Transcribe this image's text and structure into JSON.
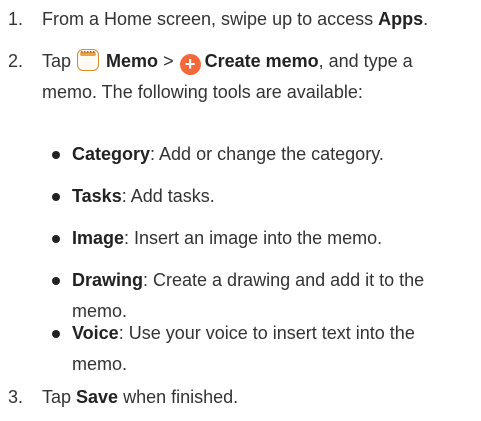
{
  "steps": [
    {
      "num": "1.",
      "pre": "From a Home screen, swipe up to access ",
      "bold": "Apps",
      "post": "."
    },
    {
      "num": "2.",
      "tap": "Tap ",
      "memo": "Memo",
      "sep": " > ",
      "create": "Create memo",
      "rest_line1": ", and type a",
      "rest_line2": "memo. The following tools are available:"
    },
    {
      "num": "3.",
      "tap": "Tap ",
      "bold": "Save",
      "post": " when finished."
    }
  ],
  "tools": [
    {
      "name": "Category",
      "desc": ": Add or change the category."
    },
    {
      "name": "Tasks",
      "desc": ": Add tasks."
    },
    {
      "name": "Image",
      "desc": ": Insert an image into the memo."
    },
    {
      "name": "Drawing",
      "desc": ": Create a drawing and add it to the memo."
    },
    {
      "name": "Voice",
      "desc": ": Use your voice to insert text into the memo."
    }
  ],
  "icons": {
    "memo_app": "memo-app-icon",
    "create_memo": "plus-circle-icon",
    "create_glyph": "+",
    "create_color": "#f26a3c",
    "memo_color": "#d88a2e"
  }
}
